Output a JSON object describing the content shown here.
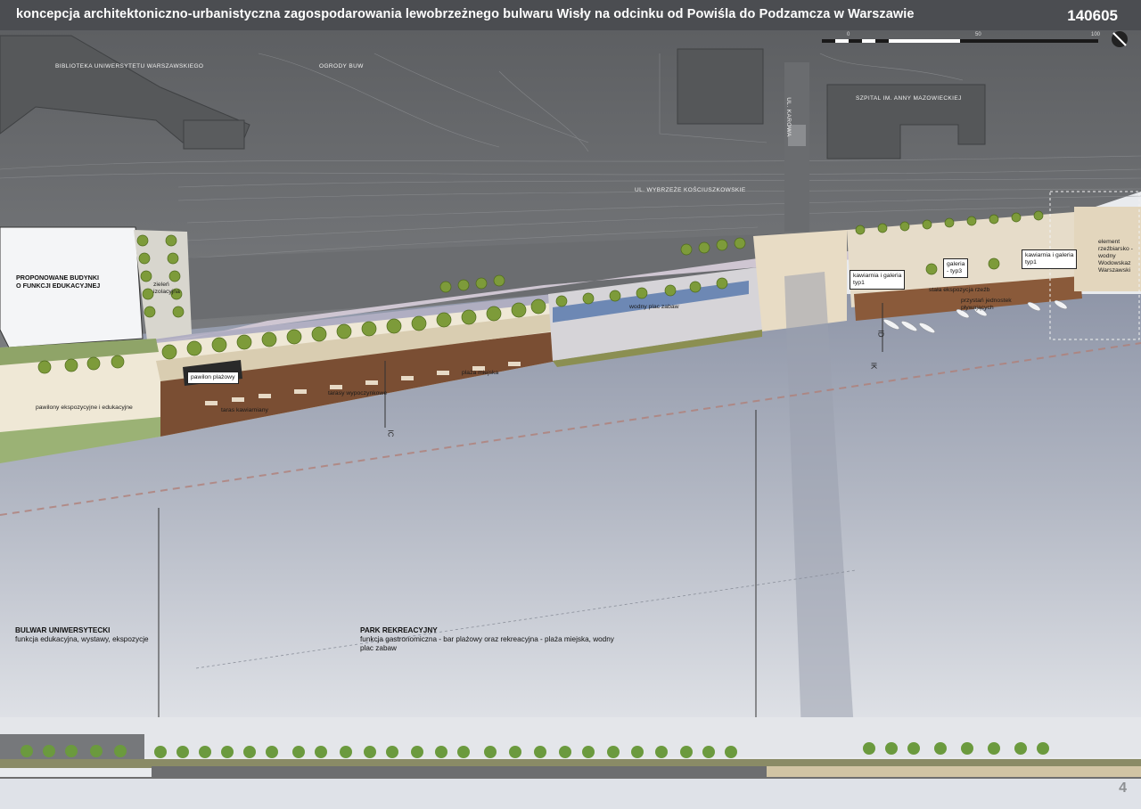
{
  "header": {
    "title": "koncepcja architektoniczno-urbanistyczna zagospodarowania lewobrzeżnego bulwaru Wisły na odcinku od Powiśla do Podzamcza w Warszawie",
    "code": "140605"
  },
  "scale_bar": {
    "ticks": [
      "0",
      "50",
      "100"
    ]
  },
  "map_labels": {
    "library": "BIBLIOTEKA UNIWERSYTETU WARSZAWSKIEGO",
    "gardens": "OGRODY BUW",
    "hospital": "SZPITAL IM. ANNY MAZOWIECKIEJ",
    "street_karowa": "UL. KAROWA",
    "street_kosciuszkowskie": "UL. WYBRZEŻE KOŚCIUSZKOWSKIE"
  },
  "plan_labels": {
    "proposed_buildings": "PROPONOWANE BUDYNKI\nO FUNKCJI EDUKACYJNEJ",
    "isolation_greenery": "zieleń\nizolacyjna",
    "beach_pavilion": "pawilon plażowy",
    "exhibition_pavilions": "pawilony ekspozycyjne i edukacyjne",
    "cafe_terrace": "taras kawiarniany",
    "recreation_terraces": "tarasy wypoczynkowe",
    "city_beach": "plaża miejska",
    "water_playground": "wodny plac zabaw",
    "cafe_gallery_1": "kawiarnia i galeria\ntyp1",
    "gallery_3": "galeria\n- typ3",
    "cafe_gallery_2": "kawiarnia i galeria\ntyp1",
    "sculpture_element": "element\nrzeźbiarsko -\nwodny\nWodowskaz\nWarszawski",
    "permanent_exhibition": "stała ekspozycja rzeźb",
    "marina": "przystań jednostek\npływających"
  },
  "section_marks": [
    "IC",
    "ID",
    "IK"
  ],
  "zones": [
    {
      "title": "BULWAR UNIWERSYTECKI",
      "desc": "funkcja edukacyjna, wystawy, ekspozycje"
    },
    {
      "title": "PARK REKREACYJNY",
      "desc": "funkcja gastronomiczna - bar plażowy oraz rekreacyjna - plaża miejska, wodny plac zabaw"
    }
  ],
  "page_number": "4",
  "colors": {
    "header": "#4b4d51",
    "basemap": "#6e7073",
    "river": "#a9afbc",
    "deck": "#7a4e33",
    "paving": "#e8e1cf",
    "trees": "#7d9b3a"
  }
}
